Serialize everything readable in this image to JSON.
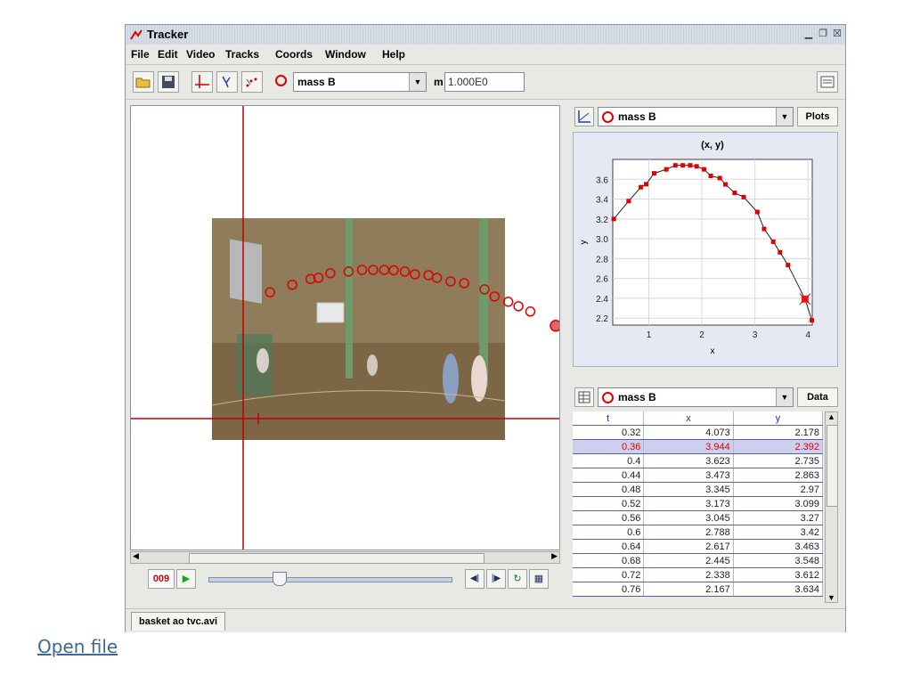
{
  "window": {
    "title": "Tracker"
  },
  "menu": [
    "File",
    "Edit",
    "Video",
    "Tracks",
    "Coords",
    "Window",
    "Help"
  ],
  "toolbar": {
    "track_name": "mass B",
    "mass_label": "m",
    "mass_value": "1.000E0"
  },
  "player": {
    "frame": "009"
  },
  "plot": {
    "track_name": "mass B",
    "button_label": "Plots"
  },
  "data_view": {
    "track_name": "mass B",
    "button_label": "Data"
  },
  "chart_data": {
    "type": "scatter",
    "title": "(x, y)",
    "xlabel": "x",
    "ylabel": "y",
    "xlim": [
      0.32,
      4.08
    ],
    "ylim": [
      2.13,
      3.8
    ],
    "x_ticks": [
      1,
      2,
      3,
      4
    ],
    "y_ticks": [
      2.2,
      2.4,
      2.6,
      2.8,
      3.0,
      3.2,
      3.4,
      3.6
    ],
    "grid": true,
    "highlight_index": 1,
    "x": [
      4.073,
      3.944,
      3.623,
      3.473,
      3.345,
      3.173,
      3.045,
      2.788,
      2.617,
      2.445,
      2.338,
      2.167,
      2.04,
      1.9,
      1.78,
      1.64,
      1.5,
      1.33,
      1.1,
      0.95,
      0.85,
      0.62,
      0.34
    ],
    "y": [
      2.178,
      2.392,
      2.735,
      2.863,
      2.97,
      3.099,
      3.27,
      3.42,
      3.463,
      3.548,
      3.612,
      3.634,
      3.7,
      3.73,
      3.74,
      3.74,
      3.74,
      3.7,
      3.66,
      3.55,
      3.52,
      3.38,
      3.2
    ],
    "color": "#e00000"
  },
  "table": {
    "columns": [
      "t",
      "x",
      "y"
    ],
    "rows": [
      [
        "0.32",
        "4.073",
        "2.178"
      ],
      [
        "0.36",
        "3.944",
        "2.392"
      ],
      [
        "0.4",
        "3.623",
        "2.735"
      ],
      [
        "0.44",
        "3.473",
        "2.863"
      ],
      [
        "0.48",
        "3.345",
        "2.97"
      ],
      [
        "0.52",
        "3.173",
        "3.099"
      ],
      [
        "0.56",
        "3.045",
        "3.27"
      ],
      [
        "0.6",
        "2.788",
        "3.42"
      ],
      [
        "0.64",
        "2.617",
        "3.463"
      ],
      [
        "0.68",
        "2.445",
        "3.548"
      ],
      [
        "0.72",
        "2.338",
        "3.612"
      ],
      [
        "0.76",
        "2.167",
        "3.634"
      ]
    ],
    "selected_row": 1
  },
  "status": {
    "file_tab": "basket ao tvc.avi"
  },
  "link": {
    "label": "Open file"
  },
  "colors": {
    "track": "#e00000",
    "axes": "#c00000",
    "selection": "#cccfee"
  }
}
